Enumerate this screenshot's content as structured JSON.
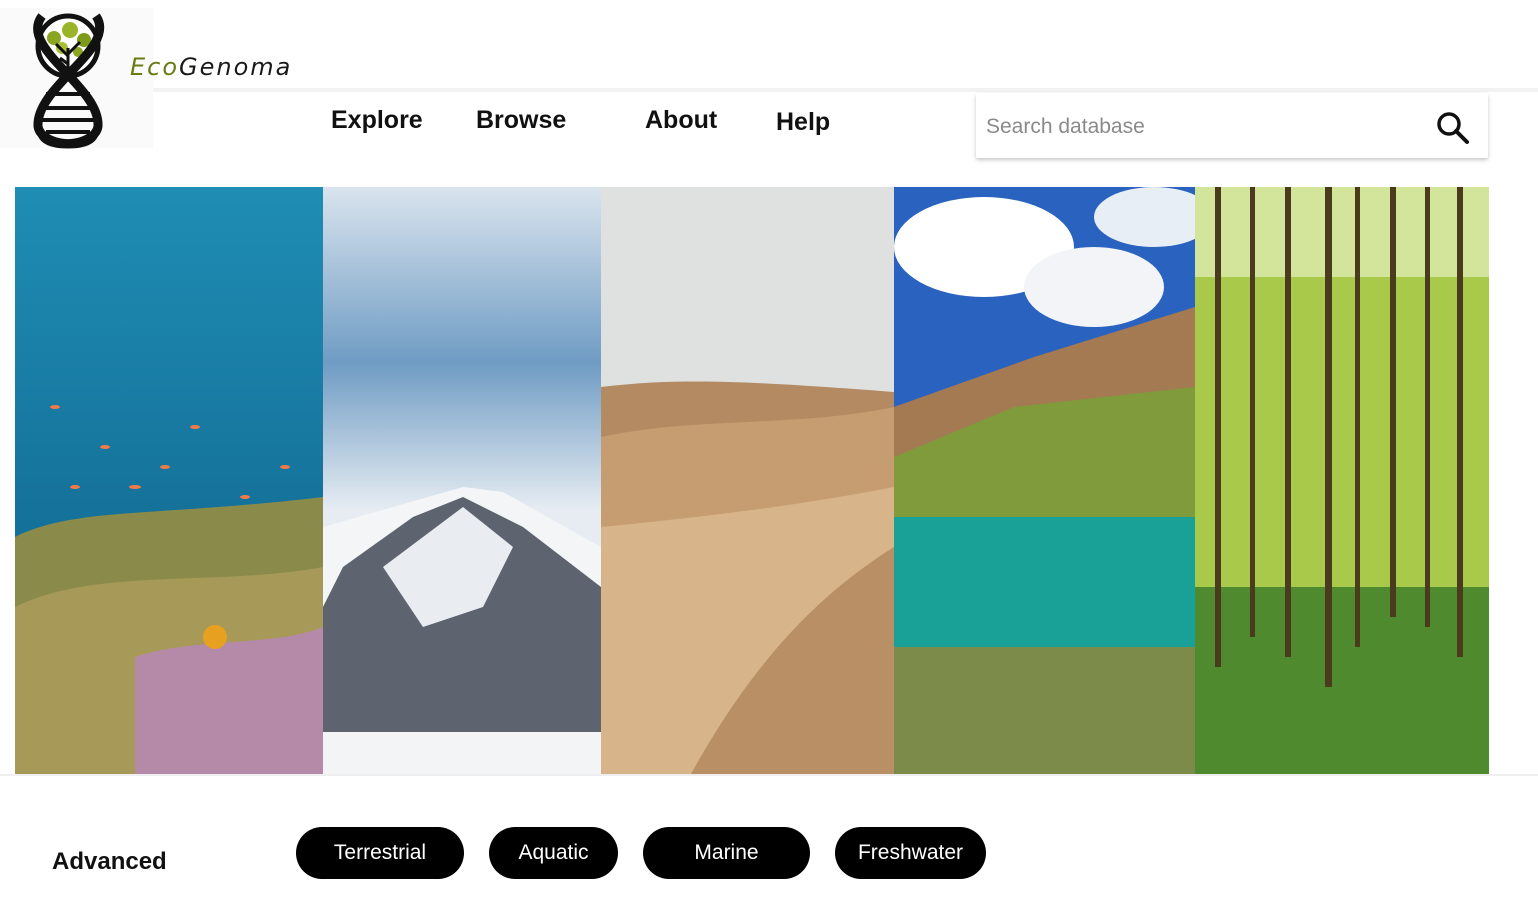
{
  "brand": {
    "prefix": "Eco",
    "suffix": "Genoma",
    "logo_icon": "dna-tree-logo"
  },
  "nav": {
    "items": [
      {
        "label": "Explore"
      },
      {
        "label": "Browse"
      },
      {
        "label": "About"
      },
      {
        "label": "Help"
      }
    ]
  },
  "search": {
    "placeholder": "Search database",
    "icon": "search-icon"
  },
  "hero": {
    "panels": [
      "coral-reef",
      "snowy-mountain",
      "desert-dunes",
      "mountain-lake",
      "forest"
    ]
  },
  "filters": {
    "heading": "Advanced",
    "options": [
      {
        "label": "Terrestrial"
      },
      {
        "label": "Aquatic"
      },
      {
        "label": "Marine"
      },
      {
        "label": "Freshwater"
      }
    ]
  },
  "colors": {
    "brand_accent": "#6b7a12",
    "pill_bg": "#000000",
    "pill_text": "#ffffff"
  }
}
